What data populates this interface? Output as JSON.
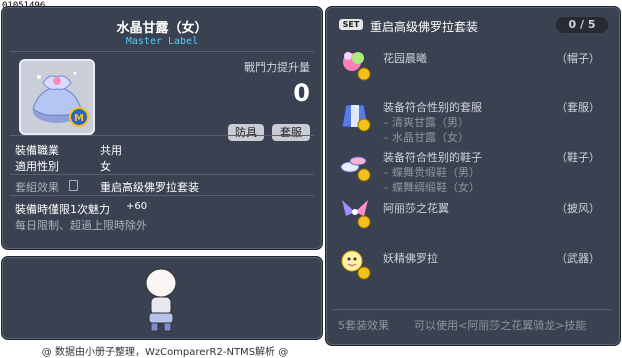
{
  "item_id": "01051496",
  "item": {
    "title": "水晶甘露（女）",
    "subtitle": "Master Label",
    "attack_label": "戰鬥力提升量",
    "attack_value": "0",
    "buttons": [
      "防具",
      "套服"
    ],
    "job_label": "裝備職業",
    "job_value": "共用",
    "gender_label": "適用性別",
    "gender_value": "女",
    "set_effect_label": "套組效果",
    "set_effect_value": "重启高级佛罗拉套装",
    "limit_text": "裝備時僅限1次魅力",
    "limit_value": "+60",
    "daily_text": "每日限制、超過上限時除外"
  },
  "set_panel": {
    "badge": "SET",
    "title": "重启高级佛罗拉套装",
    "count": "0 / 5",
    "items": [
      {
        "name": "花园晨曦",
        "type": "（帽子）",
        "subs": [],
        "icon": "flower-hat-icon"
      },
      {
        "name": "装备符合性别的套服",
        "type": "（套服）",
        "subs": [
          "– 清爽甘露（男）",
          "– 水晶甘露（女）"
        ],
        "icon": "outfit-icon"
      },
      {
        "name": "装备符合性别的鞋子",
        "type": "（鞋子）",
        "subs": [
          "– 蝶舞贵缎鞋（男）",
          "– 蝶舞绸缎鞋（女）"
        ],
        "icon": "shoes-icon"
      },
      {
        "name": "阿丽莎之花翼",
        "type": "（披风）",
        "subs": [],
        "icon": "wings-icon"
      },
      {
        "name": "妖精佛罗拉",
        "type": "（武器）",
        "subs": [],
        "icon": "fairy-weapon-icon"
      }
    ],
    "footer_left": "5套装效果",
    "footer_right": "可以使用<阿丽莎之花翼骑龙>技能"
  },
  "credit": "@ 数据由小册子整理，WzComparerR2-NTMS解析 @",
  "colors": {
    "panel_bg": "#3a4150",
    "accent_blue": "#4dd2ff",
    "coin": "#f2c21b"
  }
}
